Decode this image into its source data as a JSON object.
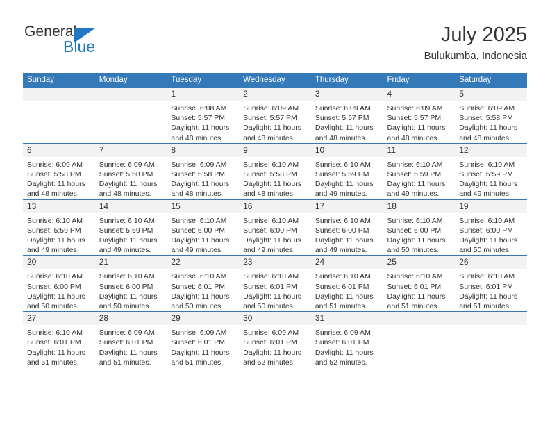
{
  "brand": {
    "name_top": "General",
    "name_bottom": "Blue",
    "triangle_icon": "brand-triangle-icon",
    "accent_color": "#1f78c1"
  },
  "header": {
    "month_title": "July 2025",
    "location": "Bulukumba, Indonesia"
  },
  "calendar": {
    "header_color": "#3479b8",
    "daynum_band_color": "#f2f2f2",
    "weekday_headers": [
      "Sunday",
      "Monday",
      "Tuesday",
      "Wednesday",
      "Thursday",
      "Friday",
      "Saturday"
    ],
    "weeks": [
      [
        {
          "day": "",
          "sunrise": "",
          "sunset": "",
          "daylight_line1": "",
          "daylight_line2": ""
        },
        {
          "day": "",
          "sunrise": "",
          "sunset": "",
          "daylight_line1": "",
          "daylight_line2": ""
        },
        {
          "day": "1",
          "sunrise": "Sunrise: 6:08 AM",
          "sunset": "Sunset: 5:57 PM",
          "daylight_line1": "Daylight: 11 hours",
          "daylight_line2": "and 48 minutes."
        },
        {
          "day": "2",
          "sunrise": "Sunrise: 6:09 AM",
          "sunset": "Sunset: 5:57 PM",
          "daylight_line1": "Daylight: 11 hours",
          "daylight_line2": "and 48 minutes."
        },
        {
          "day": "3",
          "sunrise": "Sunrise: 6:09 AM",
          "sunset": "Sunset: 5:57 PM",
          "daylight_line1": "Daylight: 11 hours",
          "daylight_line2": "and 48 minutes."
        },
        {
          "day": "4",
          "sunrise": "Sunrise: 6:09 AM",
          "sunset": "Sunset: 5:57 PM",
          "daylight_line1": "Daylight: 11 hours",
          "daylight_line2": "and 48 minutes."
        },
        {
          "day": "5",
          "sunrise": "Sunrise: 6:09 AM",
          "sunset": "Sunset: 5:58 PM",
          "daylight_line1": "Daylight: 11 hours",
          "daylight_line2": "and 48 minutes."
        }
      ],
      [
        {
          "day": "6",
          "sunrise": "Sunrise: 6:09 AM",
          "sunset": "Sunset: 5:58 PM",
          "daylight_line1": "Daylight: 11 hours",
          "daylight_line2": "and 48 minutes."
        },
        {
          "day": "7",
          "sunrise": "Sunrise: 6:09 AM",
          "sunset": "Sunset: 5:58 PM",
          "daylight_line1": "Daylight: 11 hours",
          "daylight_line2": "and 48 minutes."
        },
        {
          "day": "8",
          "sunrise": "Sunrise: 6:09 AM",
          "sunset": "Sunset: 5:58 PM",
          "daylight_line1": "Daylight: 11 hours",
          "daylight_line2": "and 48 minutes."
        },
        {
          "day": "9",
          "sunrise": "Sunrise: 6:10 AM",
          "sunset": "Sunset: 5:58 PM",
          "daylight_line1": "Daylight: 11 hours",
          "daylight_line2": "and 48 minutes."
        },
        {
          "day": "10",
          "sunrise": "Sunrise: 6:10 AM",
          "sunset": "Sunset: 5:59 PM",
          "daylight_line1": "Daylight: 11 hours",
          "daylight_line2": "and 49 minutes."
        },
        {
          "day": "11",
          "sunrise": "Sunrise: 6:10 AM",
          "sunset": "Sunset: 5:59 PM",
          "daylight_line1": "Daylight: 11 hours",
          "daylight_line2": "and 49 minutes."
        },
        {
          "day": "12",
          "sunrise": "Sunrise: 6:10 AM",
          "sunset": "Sunset: 5:59 PM",
          "daylight_line1": "Daylight: 11 hours",
          "daylight_line2": "and 49 minutes."
        }
      ],
      [
        {
          "day": "13",
          "sunrise": "Sunrise: 6:10 AM",
          "sunset": "Sunset: 5:59 PM",
          "daylight_line1": "Daylight: 11 hours",
          "daylight_line2": "and 49 minutes."
        },
        {
          "day": "14",
          "sunrise": "Sunrise: 6:10 AM",
          "sunset": "Sunset: 5:59 PM",
          "daylight_line1": "Daylight: 11 hours",
          "daylight_line2": "and 49 minutes."
        },
        {
          "day": "15",
          "sunrise": "Sunrise: 6:10 AM",
          "sunset": "Sunset: 6:00 PM",
          "daylight_line1": "Daylight: 11 hours",
          "daylight_line2": "and 49 minutes."
        },
        {
          "day": "16",
          "sunrise": "Sunrise: 6:10 AM",
          "sunset": "Sunset: 6:00 PM",
          "daylight_line1": "Daylight: 11 hours",
          "daylight_line2": "and 49 minutes."
        },
        {
          "day": "17",
          "sunrise": "Sunrise: 6:10 AM",
          "sunset": "Sunset: 6:00 PM",
          "daylight_line1": "Daylight: 11 hours",
          "daylight_line2": "and 49 minutes."
        },
        {
          "day": "18",
          "sunrise": "Sunrise: 6:10 AM",
          "sunset": "Sunset: 6:00 PM",
          "daylight_line1": "Daylight: 11 hours",
          "daylight_line2": "and 50 minutes."
        },
        {
          "day": "19",
          "sunrise": "Sunrise: 6:10 AM",
          "sunset": "Sunset: 6:00 PM",
          "daylight_line1": "Daylight: 11 hours",
          "daylight_line2": "and 50 minutes."
        }
      ],
      [
        {
          "day": "20",
          "sunrise": "Sunrise: 6:10 AM",
          "sunset": "Sunset: 6:00 PM",
          "daylight_line1": "Daylight: 11 hours",
          "daylight_line2": "and 50 minutes."
        },
        {
          "day": "21",
          "sunrise": "Sunrise: 6:10 AM",
          "sunset": "Sunset: 6:00 PM",
          "daylight_line1": "Daylight: 11 hours",
          "daylight_line2": "and 50 minutes."
        },
        {
          "day": "22",
          "sunrise": "Sunrise: 6:10 AM",
          "sunset": "Sunset: 6:01 PM",
          "daylight_line1": "Daylight: 11 hours",
          "daylight_line2": "and 50 minutes."
        },
        {
          "day": "23",
          "sunrise": "Sunrise: 6:10 AM",
          "sunset": "Sunset: 6:01 PM",
          "daylight_line1": "Daylight: 11 hours",
          "daylight_line2": "and 50 minutes."
        },
        {
          "day": "24",
          "sunrise": "Sunrise: 6:10 AM",
          "sunset": "Sunset: 6:01 PM",
          "daylight_line1": "Daylight: 11 hours",
          "daylight_line2": "and 51 minutes."
        },
        {
          "day": "25",
          "sunrise": "Sunrise: 6:10 AM",
          "sunset": "Sunset: 6:01 PM",
          "daylight_line1": "Daylight: 11 hours",
          "daylight_line2": "and 51 minutes."
        },
        {
          "day": "26",
          "sunrise": "Sunrise: 6:10 AM",
          "sunset": "Sunset: 6:01 PM",
          "daylight_line1": "Daylight: 11 hours",
          "daylight_line2": "and 51 minutes."
        }
      ],
      [
        {
          "day": "27",
          "sunrise": "Sunrise: 6:10 AM",
          "sunset": "Sunset: 6:01 PM",
          "daylight_line1": "Daylight: 11 hours",
          "daylight_line2": "and 51 minutes."
        },
        {
          "day": "28",
          "sunrise": "Sunrise: 6:09 AM",
          "sunset": "Sunset: 6:01 PM",
          "daylight_line1": "Daylight: 11 hours",
          "daylight_line2": "and 51 minutes."
        },
        {
          "day": "29",
          "sunrise": "Sunrise: 6:09 AM",
          "sunset": "Sunset: 6:01 PM",
          "daylight_line1": "Daylight: 11 hours",
          "daylight_line2": "and 51 minutes."
        },
        {
          "day": "30",
          "sunrise": "Sunrise: 6:09 AM",
          "sunset": "Sunset: 6:01 PM",
          "daylight_line1": "Daylight: 11 hours",
          "daylight_line2": "and 52 minutes."
        },
        {
          "day": "31",
          "sunrise": "Sunrise: 6:09 AM",
          "sunset": "Sunset: 6:01 PM",
          "daylight_line1": "Daylight: 11 hours",
          "daylight_line2": "and 52 minutes."
        },
        {
          "day": "",
          "sunrise": "",
          "sunset": "",
          "daylight_line1": "",
          "daylight_line2": ""
        },
        {
          "day": "",
          "sunrise": "",
          "sunset": "",
          "daylight_line1": "",
          "daylight_line2": ""
        }
      ]
    ]
  }
}
